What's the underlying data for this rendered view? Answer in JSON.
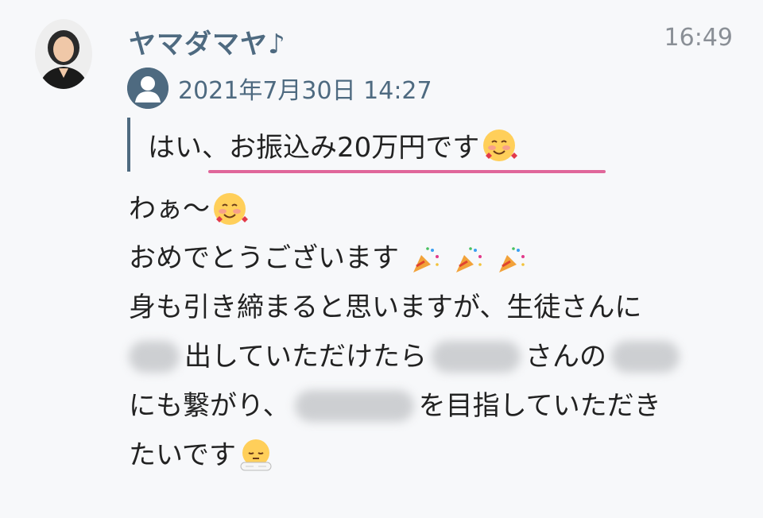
{
  "message": {
    "sender_name": "ヤマダマヤ♪",
    "time": "16:49"
  },
  "quote": {
    "date": "2021年7月30日 14:27",
    "text": "はい、お振込み20万円です"
  },
  "body_lines": {
    "line1": "わぁ〜",
    "line2": "おめでとうございます",
    "line3": "身も引き締まると思いますが、生徒さんに",
    "line4a": "出していただけたら",
    "line4b": "さんの",
    "line5a": "にも繋がり、",
    "line5b": "を目指していただき",
    "line6": "たいです"
  },
  "icons": {
    "avatar": "user-photo-avatar",
    "quote_avatar": "default-user-icon",
    "face_emoji": "smiling-face-with-hearts",
    "popper_emoji": "party-popper",
    "bow_emoji": "bowing-face"
  },
  "colors": {
    "accent": "#4e6a80",
    "underline": "#e0679a",
    "text": "#222222",
    "muted": "#8a8f96",
    "background": "#f7f8fa"
  }
}
